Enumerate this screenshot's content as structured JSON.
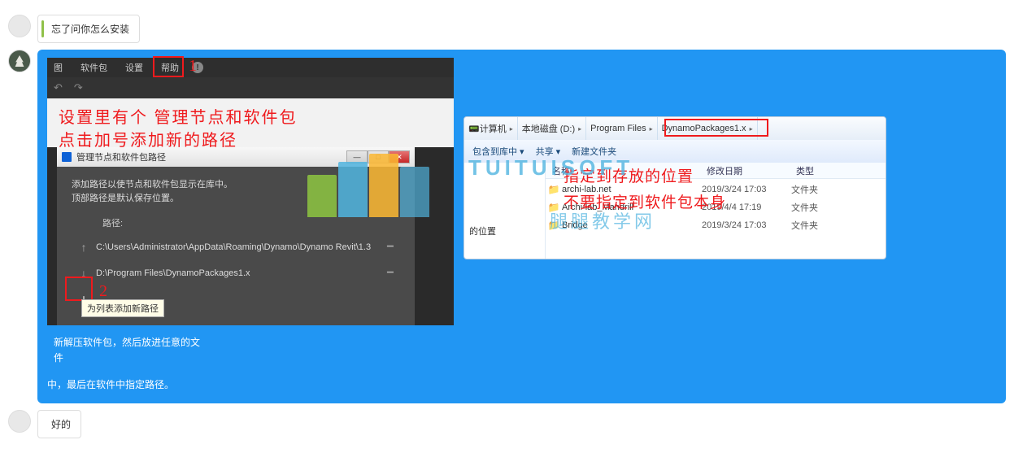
{
  "msg1": {
    "text": "忘了问你怎么安装"
  },
  "msg3": {
    "text": "好的"
  },
  "dynamo": {
    "menu": {
      "item1": "图",
      "item2": "软件包",
      "item3": "设置",
      "item4": "帮助"
    },
    "toolbar": {
      "undo": "↶",
      "redo": "↷"
    },
    "annot1": "1",
    "overlay_line1": "设置里有个 管理节点和软件包",
    "overlay_line2": "点击加号添加新的路径"
  },
  "pathDialog": {
    "title": "管理节点和软件包路径",
    "desc1": "添加路径以使节点和软件包显示在库中。",
    "desc2": "顶部路径是默认保存位置。",
    "head": "路径:",
    "path1": "C:\\Users\\Administrator\\AppData\\Roaming\\Dynamo\\Dynamo Revit\\1.3",
    "path2": "D:\\Program Files\\DynamoPackages1.x",
    "tooltip": "为列表添加新路径",
    "annot2": "2",
    "winMin": "—",
    "winMax": "□",
    "winClose": "✕"
  },
  "watermark": {
    "text": "TUITUISOFT",
    "cn": "腿腿教学网"
  },
  "explorer": {
    "crumbs": {
      "c1": "计算机",
      "c2": "本地磁盘 (D:)",
      "c3": "Program Files",
      "c4": "DynamoPackages1.x"
    },
    "toolbar": {
      "include": "包含到库中",
      "share": "共享",
      "newfolder": "新建文件夹"
    },
    "side": {
      "s1": "的位置"
    },
    "cols": {
      "name": "名称",
      "date": "修改日期",
      "type": "类型"
    },
    "rows": [
      {
        "name": "archi-lab.net",
        "date": "2019/3/24 17:03",
        "type": "文件夹"
      },
      {
        "name": "Archi-lab_Mandrill",
        "date": "2019/4/4 17:19",
        "type": "文件夹"
      },
      {
        "name": "Bridge",
        "date": "2019/3/24 17:03",
        "type": "文件夹"
      }
    ],
    "overlay1": "指定到存放的位置",
    "overlay2": "不要指定到软件包本身"
  },
  "blueTrail": "新解压软件包，然后放进任意的文件",
  "bluePost": "中，最后在软件中指定路径。"
}
